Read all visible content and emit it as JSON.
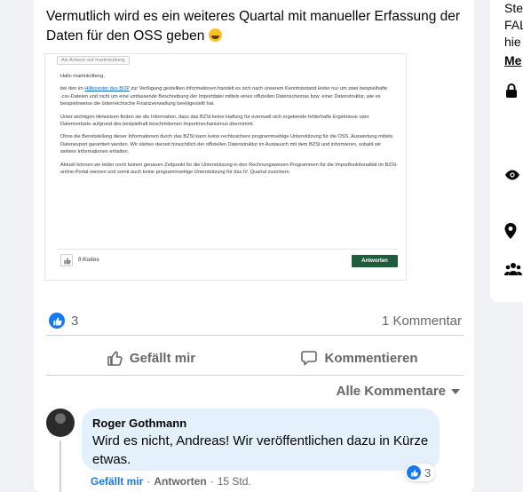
{
  "post": {
    "text": "Vermutlich wird es ein weiteres Quartal mit manueller Erfassung der Daten für den OSS geben",
    "emoji": "crying-face-emoji"
  },
  "screenshot": {
    "quote_label": "Als Antwort auf martinkolberg",
    "greeting": "Hallo martinkolberg,",
    "p1_a": "bei den im ",
    "p1_link": "Hilfecenter des BOP",
    "p1_b": " zur Verfügung gestellten Informationen handelt es sich nach unserem Kenntnisstand leider nur um zwei beispielhafte .csv-Dateien und nicht um eine umfassende Beschreibung der Importdatei mittels eines offiziellen Datenschemas bzw. einer Datenstruktur, wie es beispielsweise die österreichische Finanzverwaltung bereitgestellt hat.",
    "p2": "Unter wichtigen Hinweisen finden sie die Information, dass das BZSt keine Haftung für eventuell sich ergebende fehlerhafte Ergebnisse oder Datenverluste aufgrund des beispielhaft beschriebenen Importmechanismus übernimmt.",
    "p3": "Ohne die Bereitstellung dieser Informationen durch das BZSt kann keine rechtssichere programmseitige Unterstützung für die OSS. Auswertung mittels Datenexport garantiert werden. Wir stehen derzeit hinsichtlich der offiziellen Datenstruktur im Austausch mit dem BZSt und informieren, sobald wir weitere Informationen erhalten.",
    "p4": "Aktuell können wir leider noch keinen genauen Zeitpunkt für die Unterstützung in den Rechnungswesen-Programmen für die Importfunktionalität im BZSt-online-Portal nennen und somit auch keine programmseitige Unterstützung für das IV. Quartal zusichern.",
    "kudos": "0 Kudos",
    "reply_button": "Antworten"
  },
  "stats": {
    "reactions": "3",
    "comments": "1 Kommentar"
  },
  "actions": {
    "like": "Gefällt mir",
    "comment": "Kommentieren"
  },
  "sort": {
    "label": "Alle Kommentare"
  },
  "comment": {
    "author": "Roger Gothmann",
    "text": "Wird es nicht, Andreas! Wir veröffentlichen dazu in Kürze etwas.",
    "reactions": "3",
    "like": "Gefällt mir",
    "reply": "Antworten",
    "sep": "·",
    "time": "15 Std."
  },
  "sidebar": {
    "line1": "Ste",
    "line2": "FAL",
    "line3": "hie",
    "link": "Me"
  },
  "colors": {
    "accent": "#1877f2",
    "bubble": "#e4f1fc",
    "reply_button": "#1f5c3b"
  }
}
